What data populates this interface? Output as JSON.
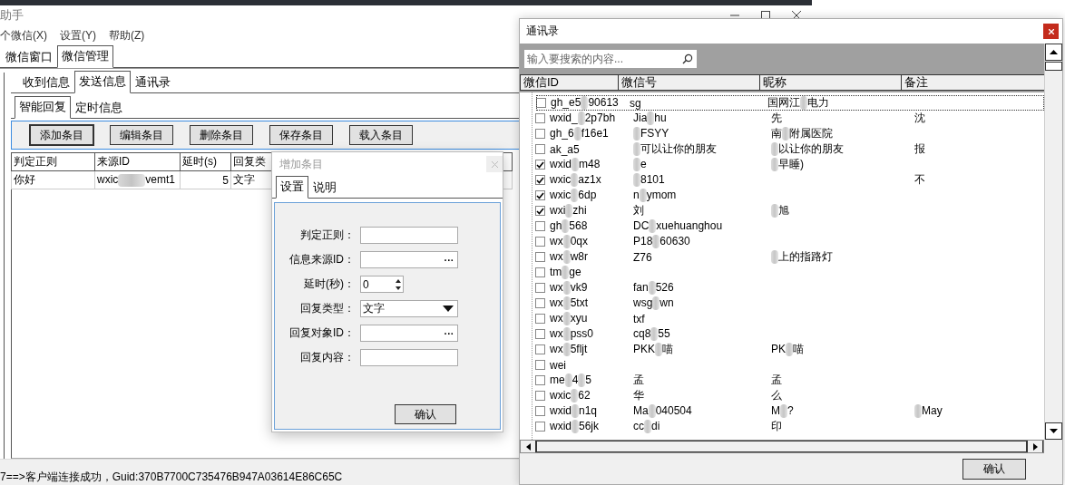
{
  "main_window": {
    "title": "助手",
    "menu": [
      "个微信(X)",
      "设置(Y)",
      "帮助(Z)"
    ],
    "tabs": [
      {
        "label": "微信窗口",
        "selected": false
      },
      {
        "label": "微信管理",
        "selected": true
      }
    ],
    "subtabs": [
      {
        "label": "收到信息",
        "selected": false
      },
      {
        "label": "发送信息",
        "selected": true
      },
      {
        "label": "通讯录",
        "selected": false
      }
    ],
    "inner_tabs": [
      {
        "label": "智能回复",
        "selected": true
      },
      {
        "label": "定时信息",
        "selected": false
      }
    ],
    "toolbar": [
      "添加条目",
      "编辑条目",
      "删除条目",
      "保存条目",
      "载入条目"
    ],
    "table": {
      "columns": [
        "判定正则",
        "来源ID",
        "延时(s)",
        "回复类"
      ],
      "rows": [
        {
          "cells": [
            [
              "你好"
            ],
            [
              "wxic",
              "vemt1"
            ],
            [
              "5"
            ],
            [
              "文字"
            ]
          ]
        }
      ]
    },
    "status_bar": "7==>客户端连接成功，Guid:370B7700C735476B947A03614E86C65C"
  },
  "add_dialog": {
    "title": "增加条目",
    "tabs": [
      {
        "label": "设置",
        "selected": true
      },
      {
        "label": "说明",
        "selected": false
      }
    ],
    "fields": [
      {
        "kind": "text",
        "label": "判定正则："
      },
      {
        "kind": "browse",
        "label": "信息来源ID：",
        "button": "···"
      },
      {
        "kind": "spin",
        "label": "延时(秒)：",
        "value": "0"
      },
      {
        "kind": "select",
        "label": "回复类型：",
        "value": "文字"
      },
      {
        "kind": "browse",
        "label": "回复对象ID：",
        "button": "···"
      },
      {
        "kind": "text",
        "label": "回复内容："
      }
    ],
    "button": "确认"
  },
  "contacts_dialog": {
    "title": "通讯录",
    "search": {
      "placeholder": "输入要搜索的内容..."
    },
    "columns": [
      "微信ID",
      "微信号",
      "昵称",
      "备注"
    ],
    "rows": [
      {
        "checked": false,
        "cells": [
          [
            "gh_e5",
            "90613"
          ],
          [
            "sg"
          ],
          [
            "国网江",
            "电力"
          ],
          []
        ]
      },
      {
        "checked": false,
        "cells": [
          [
            "wxid_",
            "2p7bh"
          ],
          [
            "Jia",
            "hu"
          ],
          [
            "先"
          ],
          [
            "沈"
          ]
        ]
      },
      {
        "checked": false,
        "cells": [
          [
            "gh_6",
            "f16e1"
          ],
          [
            "",
            "FSYY"
          ],
          [
            "南",
            "附属医院"
          ],
          []
        ]
      },
      {
        "checked": false,
        "cells": [
          [
            "ak_a5"
          ],
          [
            "",
            "可以让你的朋友"
          ],
          [
            "",
            "以让你的朋友"
          ],
          [
            "报"
          ]
        ]
      },
      {
        "checked": true,
        "cells": [
          [
            "wxid",
            "m48"
          ],
          [
            "",
            "e"
          ],
          [
            "",
            "早睡)"
          ],
          []
        ]
      },
      {
        "checked": true,
        "cells": [
          [
            "wxic",
            "az1x"
          ],
          [
            "",
            "8101"
          ],
          [],
          [
            "不"
          ]
        ]
      },
      {
        "checked": true,
        "cells": [
          [
            "wxic",
            "6dp"
          ],
          [
            "n",
            "ymom"
          ],
          [],
          []
        ]
      },
      {
        "checked": true,
        "cells": [
          [
            "wxi",
            "zhi"
          ],
          [
            "刘"
          ],
          [
            "",
            "旭"
          ],
          []
        ]
      },
      {
        "checked": false,
        "cells": [
          [
            "gh",
            "568"
          ],
          [
            "DC",
            "xuehuanghou"
          ],
          [],
          []
        ]
      },
      {
        "checked": false,
        "cells": [
          [
            "wx",
            "0qx"
          ],
          [
            "P18",
            "60630"
          ],
          [],
          []
        ]
      },
      {
        "checked": false,
        "cells": [
          [
            "wx",
            "w8r"
          ],
          [
            "Z76"
          ],
          [
            "",
            "上的指路灯"
          ],
          []
        ]
      },
      {
        "checked": false,
        "cells": [
          [
            "tm",
            "ge"
          ],
          [],
          [],
          []
        ]
      },
      {
        "checked": false,
        "cells": [
          [
            "wx",
            "vk9"
          ],
          [
            "fan",
            "526"
          ],
          [],
          []
        ]
      },
      {
        "checked": false,
        "cells": [
          [
            "wx",
            "5txt"
          ],
          [
            "wsg",
            "wn"
          ],
          [],
          []
        ]
      },
      {
        "checked": false,
        "cells": [
          [
            "wx",
            "xyu"
          ],
          [
            "txf"
          ],
          [],
          []
        ]
      },
      {
        "checked": false,
        "cells": [
          [
            "wx",
            "pss0"
          ],
          [
            "cq8",
            "55"
          ],
          [],
          []
        ]
      },
      {
        "checked": false,
        "cells": [
          [
            "wx",
            "5fljt"
          ],
          [
            "PKK",
            "喵"
          ],
          [
            "PK",
            "喵"
          ],
          []
        ]
      },
      {
        "checked": false,
        "cells": [
          [
            "wei"
          ],
          [],
          [],
          []
        ]
      },
      {
        "checked": false,
        "cells": [
          [
            "me",
            "4",
            "5"
          ],
          [
            "孟"
          ],
          [
            "孟"
          ],
          []
        ]
      },
      {
        "checked": false,
        "cells": [
          [
            "wxic",
            "62"
          ],
          [
            "华"
          ],
          [
            "么"
          ],
          []
        ]
      },
      {
        "checked": false,
        "cells": [
          [
            "wxid",
            "n1q"
          ],
          [
            "Ma",
            "040504"
          ],
          [
            "M",
            "?"
          ],
          [
            "",
            "May"
          ]
        ]
      },
      {
        "checked": false,
        "cells": [
          [
            "wxid",
            "56jk"
          ],
          [
            "cc",
            "di"
          ],
          [
            "印"
          ],
          []
        ]
      }
    ],
    "button": "确认"
  }
}
